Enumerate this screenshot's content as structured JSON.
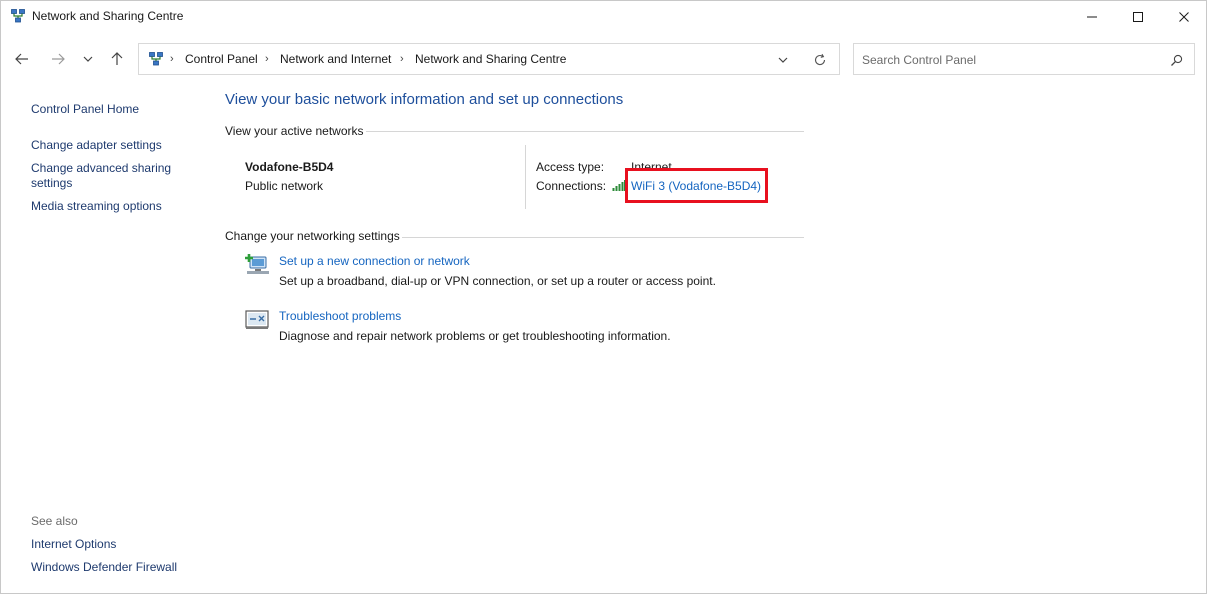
{
  "window": {
    "title": "Network and Sharing Centre"
  },
  "address_bar": {
    "crumbs": [
      "Control Panel",
      "Network and Internet",
      "Network and Sharing Centre"
    ]
  },
  "search": {
    "placeholder": "Search Control Panel"
  },
  "left_pane": {
    "links": [
      "Control Panel Home",
      "Change adapter settings",
      "Change advanced sharing",
      "settings",
      "Media streaming options"
    ],
    "see_also_label": "See also",
    "see_also_links": [
      "Internet Options",
      "Windows Defender Firewall"
    ]
  },
  "main": {
    "heading": "View your basic network information and set up connections",
    "active_networks_label": "View your active networks",
    "network": {
      "name": "Vodafone-B5D4",
      "type": "Public network",
      "access_type_label": "Access type:",
      "access_type_value": "Internet",
      "connections_label": "Connections:",
      "connection_link": "WiFi 3 (Vodafone-B5D4)"
    },
    "settings_label": "Change your networking settings",
    "tasks": [
      {
        "link": "Set up a new connection or network",
        "desc": "Set up a broadband, dial-up or VPN connection, or set up a router or access point."
      },
      {
        "link": "Troubleshoot problems",
        "desc": "Diagnose and repair network problems or get troubleshooting information."
      }
    ]
  },
  "colors": {
    "link": "#1565c0",
    "heading": "#1e4f9c",
    "highlight": "#e8101f"
  }
}
